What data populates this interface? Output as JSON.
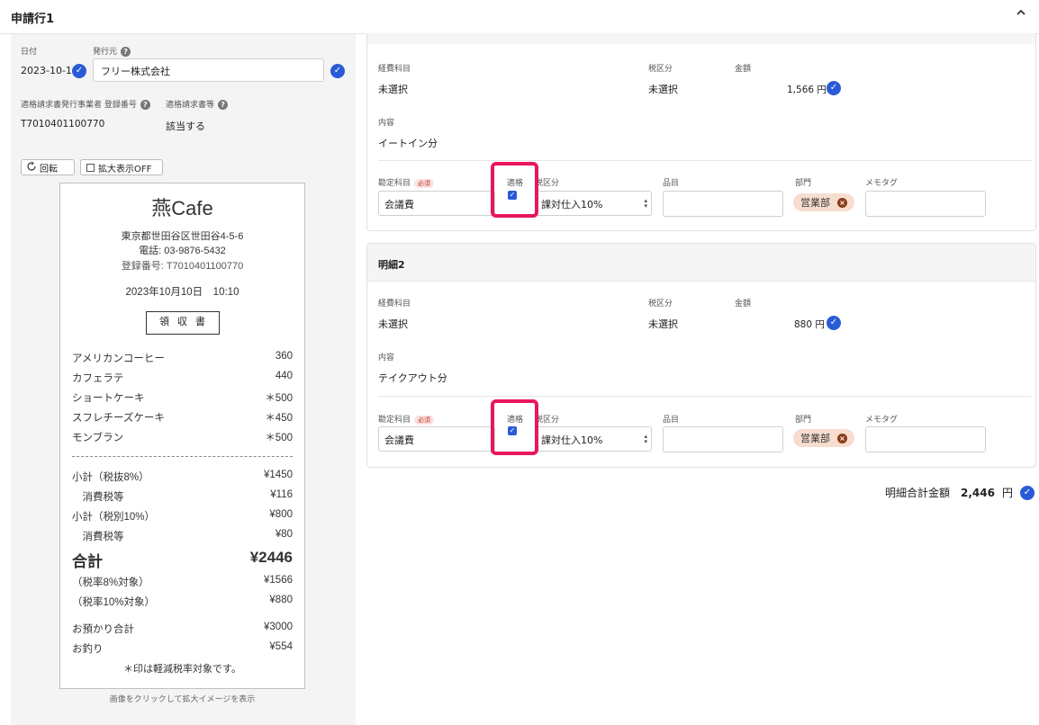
{
  "header": {
    "title": "申請行1",
    "collapse_icon": "chevron-up"
  },
  "left": {
    "date_label": "日付",
    "date_value": "2023-10-10",
    "issuer_label": "発行元",
    "issuer_value": "フリー株式会社",
    "reg_label": "適格請求書発行事業者 登録番号",
    "reg_value": "T7010401100770",
    "qualified_label": "適格請求書等",
    "qualified_value": "該当する",
    "rotate_label": "回転",
    "zoom_label": "拡大表示OFF",
    "caption": "画像をクリックして拡大イメージを表示"
  },
  "receipt": {
    "shop": "燕Cafe",
    "address": "東京都世田谷区世田谷4-5-6",
    "phone": "電話: 03-9876-5432",
    "reg": "登録番号: T7010401100770",
    "datetime": "2023年10月10日　10:10",
    "doc_title": "領収書",
    "items": [
      {
        "name": "アメリカンコーヒー",
        "price": "360"
      },
      {
        "name": "カフェラテ",
        "price": "440"
      },
      {
        "name": "ショートケーキ",
        "price": "＊500"
      },
      {
        "name": "スフレチーズケーキ",
        "price": "＊450"
      },
      {
        "name": "モンブラン",
        "price": "＊500"
      }
    ],
    "summary": [
      {
        "name": "小計（税抜8%）",
        "price": "¥1450"
      },
      {
        "name": "　消費税等",
        "price": "¥116"
      },
      {
        "name": "小計（税別10%）",
        "price": "¥800"
      },
      {
        "name": "　消費税等",
        "price": "¥80"
      }
    ],
    "total_label": "合計",
    "total_value": "¥2446",
    "breakdown": [
      {
        "name": "（税率8%対象）",
        "price": "¥1566"
      },
      {
        "name": "（税率10%対象）",
        "price": "¥880"
      }
    ],
    "paid_label": "お預かり合計",
    "paid_value": "¥3000",
    "change_label": "お釣り",
    "change_value": "¥554",
    "note": "＊印は軽減税率対象です。"
  },
  "labels": {
    "expense_item": "経費科目",
    "tax_category": "税区分",
    "amount": "金額",
    "content": "内容",
    "account": "勘定科目",
    "required": "必須",
    "qualified": "適格",
    "tax_category2": "税区分",
    "product": "品目",
    "department": "部門",
    "memo_tag": "メモタグ",
    "unselected": "未選択",
    "yen": "円"
  },
  "line1": {
    "amount": "1,566",
    "content": "イートイン分",
    "account": "会議費",
    "tax": "課対仕入10%",
    "department": "営業部"
  },
  "line2": {
    "title": "明細2",
    "amount": "880",
    "content": "テイクアウト分",
    "account": "会議費",
    "tax": "課対仕入10%",
    "department": "営業部"
  },
  "total": {
    "label": "明細合計金額",
    "value": "2,446",
    "unit": "円"
  },
  "colors": {
    "accent": "#2a5bd7",
    "highlight": "#e8175d",
    "tag_bg": "#f7ddce"
  }
}
